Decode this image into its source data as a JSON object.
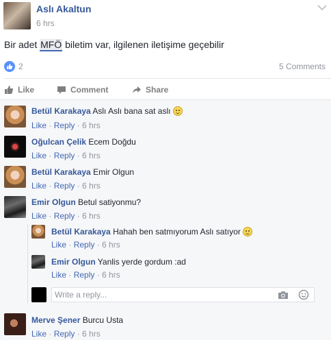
{
  "post": {
    "author": "Aslı Akaltun",
    "time": "6 hrs",
    "text_before": "Bir adet ",
    "tag": "MFÖ",
    "text_after": " biletim var, ilgilenen iletişime geçebilir",
    "like_count": "2",
    "comments_count": "5 Comments"
  },
  "actions": {
    "like": "Like",
    "comment": "Comment",
    "share": "Share"
  },
  "comments": [
    {
      "author": "Betül Karakaya",
      "text": "Aslı Aslı bana sat aslı",
      "like": "Like",
      "reply": "Reply",
      "time": "6 hrs"
    },
    {
      "author": "Oğulcan Çelik",
      "text": "Ecem Doğdu",
      "like": "Like",
      "reply": "Reply",
      "time": "6 hrs"
    },
    {
      "author": "Betül Karakaya",
      "text": "Emir Olgun",
      "like": "Like",
      "reply": "Reply",
      "time": "6 hrs"
    },
    {
      "author": "Emir Olgun",
      "text": "Betul satiyonmu?",
      "like": "Like",
      "reply": "Reply",
      "time": "6 hrs"
    },
    {
      "author": "Merve Şener",
      "text": "Burcu Usta",
      "like": "Like",
      "reply": "Reply",
      "time": "6 hrs"
    }
  ],
  "replies": [
    {
      "author": "Betül Karakaya",
      "text": "Hahah ben satmıyorum Aslı satıyor",
      "like": "Like",
      "reply": "Reply",
      "time": "6 hrs"
    },
    {
      "author": "Emir Olgun",
      "text": "Yanlis yerde gordum :ad",
      "like": "Like",
      "reply": "Reply",
      "time": "6 hrs"
    }
  ],
  "reply_box": {
    "placeholder": "Write a reply..."
  },
  "colors": {
    "link": "#365899",
    "meta": "#90949c",
    "like_blue": "#5890ff",
    "comments_bg": "#f6f7f9"
  },
  "icons": [
    "chevron-down-icon",
    "thumbs-up-icon",
    "comment-icon",
    "share-icon",
    "camera-icon",
    "smiley-icon"
  ]
}
